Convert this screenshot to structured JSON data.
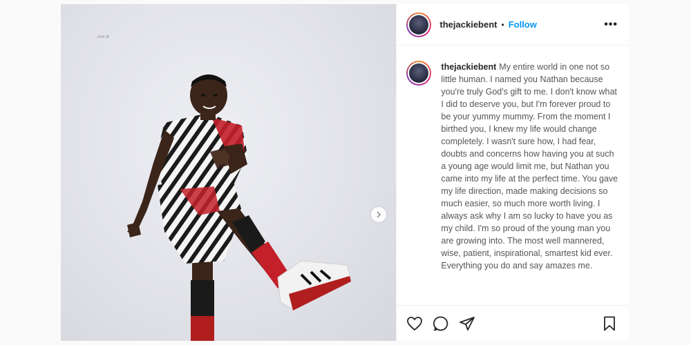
{
  "post": {
    "username": "thejackiebent",
    "separator": "•",
    "follow_label": "Follow",
    "more_label": "•••",
    "watermark": "ᴶᴬᴷᴵᴱ",
    "caption": "My entire world in one not so little human. I named you Nathan because you're truly God's gift to me. I don't know what I did to deserve you, but I'm forever proud to be your yummy mummy. From the moment I birthed you, I knew my life would change completely. I wasn't sure how, I had fear, doubts and concerns how having you at such a young age would limit me, but Nathan you came into my life at the perfect time. You gave my life direction, made making decisions so much easier, so much more worth living. I always ask why I am so lucky to have you as my child. I'm so proud of the young man you are growing into. The most well mannered, wise, patient, inspirational, smartest kid ever. Everything you do and say amazes me."
  },
  "icons": {
    "like": "heart-icon",
    "comment": "comment-icon",
    "share": "paper-plane-icon",
    "save": "bookmark-icon",
    "next": "chevron-right-icon"
  },
  "colors": {
    "follow": "#0095f6",
    "text": "#262626",
    "caption": "#555555"
  }
}
